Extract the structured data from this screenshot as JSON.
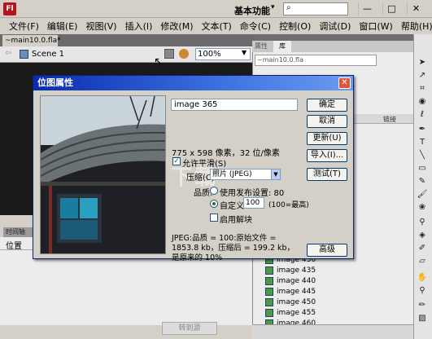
{
  "app": {
    "logo": "Fl",
    "workspace": "基本功能",
    "workspace_caret": "▾"
  },
  "window_controls": {
    "minimize": "—",
    "maximize": "□",
    "close": "✕"
  },
  "menu": [
    "文件(F)",
    "编辑(E)",
    "视图(V)",
    "插入(I)",
    "修改(M)",
    "文本(T)",
    "命令(C)",
    "控制(O)",
    "调试(D)",
    "窗口(W)",
    "帮助(H)"
  ],
  "document": {
    "tab": "~main10.0.fla*",
    "tab_close": "×",
    "scene": "Scene 1",
    "zoom": "100%"
  },
  "timeline": {
    "tab": "时间轴",
    "layer_label": "位置",
    "bottom_button": "转到源"
  },
  "library": {
    "tab_properties": "属性",
    "tab_library": "库",
    "file": "~main10.0.fla",
    "column_linkage": "链接",
    "items": [
      "image 430",
      "image 435",
      "image 440",
      "image 445",
      "image 450",
      "image 455",
      "image 460"
    ]
  },
  "dialog": {
    "title": "位图属性",
    "close": "✕",
    "name_value": "image 365",
    "dimensions": "775 x 598 像素，32 位/像素",
    "allow_smoothing": "允许平滑(S)",
    "compress_label": "压缩(C):",
    "compress_value": "照片 (JPEG)",
    "quality_label": "品质:",
    "use_publish": "使用发布设置: 80",
    "custom": "自定义:",
    "quality_value": "100",
    "quality_hint": "(100=最高)",
    "deblock": "启用解块",
    "info": "JPEG:品质 = 100:原始文件 = 1853.8 kb，压缩后 = 199.2 kb，是原来的 10%",
    "buttons": {
      "ok": "确定",
      "cancel": "取消",
      "update": "更新(U)",
      "import": "导入(I)...",
      "test": "测试(T)",
      "advanced": "高级"
    },
    "watermark": "下载"
  },
  "colors": {
    "titlebar_gradient_start": "#0a2bb0",
    "titlebar_gradient_end": "#6b9cf0",
    "stage": "#1a1a1a",
    "flash_red": "#b3161b"
  }
}
